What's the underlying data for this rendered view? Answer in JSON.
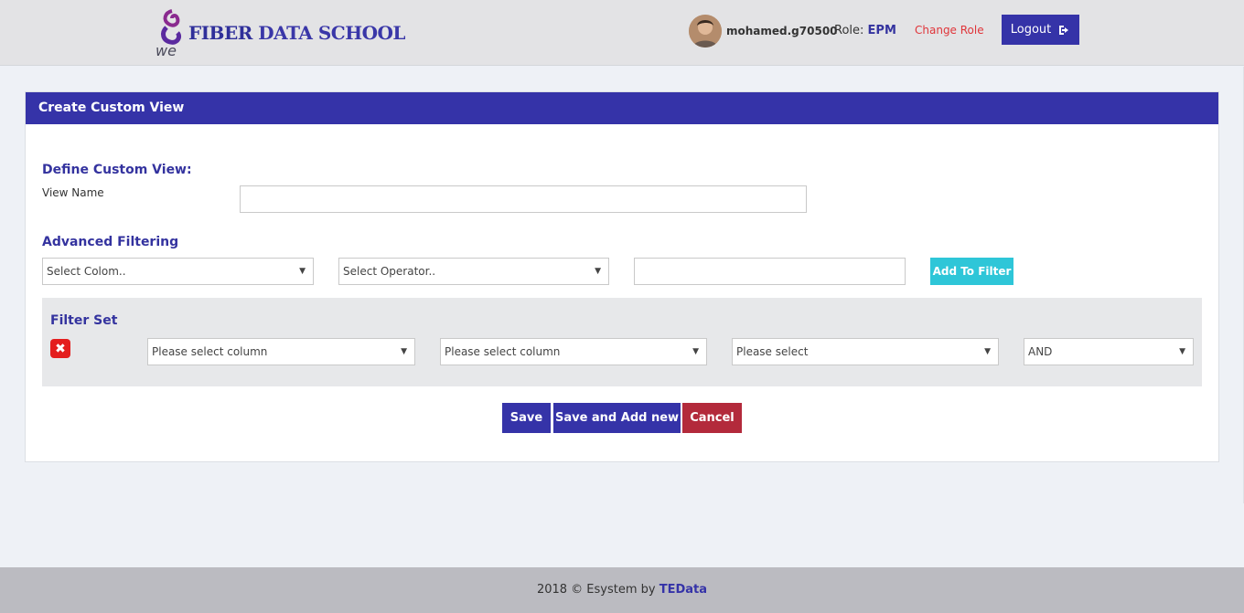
{
  "header": {
    "logo_text_1": "FIBER",
    "logo_text_2": "DATA SCHOOL",
    "logo_sub": "we",
    "username": "mohamed.g70500",
    "role_label": "Role:",
    "role_value": "EPM",
    "change_role_label": "Change Role",
    "logout_label": "Logout",
    "logout_icon": "logout-icon"
  },
  "panel": {
    "title": "Create Custom View",
    "define_title": "Define Custom View:",
    "view_name_label": "View Name",
    "view_name_value": "",
    "advanced_title": "Advanced Filtering",
    "column_select": "Select Colom..",
    "operator_select": "Select Operator..",
    "filter_value": "",
    "add_to_filter_label": "Add To Filter",
    "filter_set_title": "Filter Set",
    "filter_row": {
      "column_1": "Please select column",
      "column_2": "Please select column",
      "value_select": "Please select",
      "logic_select": "AND"
    },
    "save_label": "Save",
    "save_add_label": "Save and Add new",
    "cancel_label": "Cancel"
  },
  "footer": {
    "text": "2018 © Esystem by",
    "brand": "TEData"
  },
  "colors": {
    "brand": "#3533a8",
    "accent_cyan": "#2ec6d8",
    "danger": "#b32a3b",
    "remove": "#e41e1e",
    "change_role": "#e0353a"
  }
}
